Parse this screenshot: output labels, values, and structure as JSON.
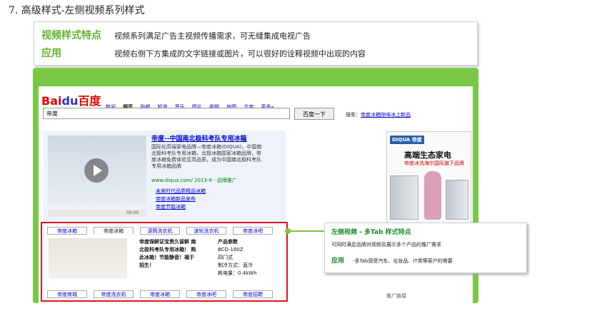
{
  "heading": "7. 高级样式-左侧视频系列样式",
  "features": {
    "label1": "视频样式特点",
    "text1": "视频系列满足广告主视频传播需求，可无缝集成电视广告",
    "label2": "应用",
    "text2": "视频右侧下方集成的文字链接或图片，可以很好的诠释视频中出现的内容"
  },
  "browser": {
    "logo_bai": "Bai",
    "logo_du": "du",
    "logo_cn": "百度",
    "nav": [
      "新闻",
      "网页",
      "贴吧",
      "知道",
      "音乐",
      "图片",
      "视频",
      "地图",
      "文库",
      "更多»"
    ],
    "search_value": "帝度",
    "search_button": "百度一下",
    "hint_prefix": "搜索",
    "hint_link": "帝度冰箱除味冰上新品"
  },
  "result": {
    "title": "帝度--中国南北极科考队专用冰箱",
    "desc": "国际化高端家电品牌—帝度冰箱(DIQUA)，中国南北极科考队专用冰箱，北极冰箱国家冰箱品牌，帝度冰箱免费体验至高品质，成为中国南北极科考队专用冰箱品牌",
    "url": "www.diqua.com/ 2013-9 - 品牌推广",
    "sublinks": [
      "未来时代品质精品冰箱",
      "帝度冰箱新品发布",
      "帝度节能冰箱"
    ],
    "video_time": "00:00"
  },
  "ad": {
    "brand": "DIQUA 帝度",
    "title": "高端生态家电",
    "subtitle": "帝度冰洗海尔国际旗下品牌",
    "footer": "推广链接"
  },
  "tabs": {
    "top": [
      "帝度冰箱",
      "帝度冰箱",
      "滚筒洗衣机",
      "波轮洗衣机",
      "帝度冰吧"
    ],
    "bottom": [
      "帝度商城",
      "帝度洗衣机",
      "帝度冰箱",
      "帝度冰吧",
      "帝度招聘"
    ]
  },
  "product": {
    "text": "帝度保鲜证宝贵久留鲜 南北极科考队专用冰箱！ 购此冰箱！节能静音！福于招生！",
    "spec_title": "产品参数",
    "spec_lines": [
      "BCD-180Z",
      "四门式",
      "制冷方式：直冷",
      "耗电量：0.4kWh"
    ]
  },
  "callout": {
    "title": "左侧视频 - 多Tab 样式特点",
    "text": "可同时满足品牌对视频及展示多个产品的推广需求",
    "label": "应用",
    "text2": "-多Tab感受汽车、化妆品、IT类等客户的需要"
  }
}
